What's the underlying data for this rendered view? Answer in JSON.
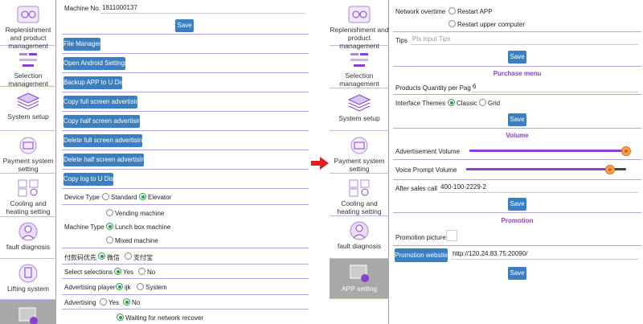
{
  "sidebar_left": [
    {
      "label": "Replenishment and product management",
      "icon": "replenish-icon"
    },
    {
      "label": "Selection management",
      "icon": "selection-icon"
    },
    {
      "label": "System setup",
      "icon": "layers-icon"
    },
    {
      "label": "Payment system setting",
      "icon": "payment-icon"
    },
    {
      "label": "Cooling and heating setting",
      "icon": "cooling-icon"
    },
    {
      "label": "fault diagnosis",
      "icon": "doctor-icon"
    },
    {
      "label": "Lifting system",
      "icon": "lifting-icon"
    },
    {
      "label": "",
      "icon": "app-setting-icon"
    }
  ],
  "sidebar_right": [
    {
      "label": "Replenishment and product management",
      "icon": "replenish-icon"
    },
    {
      "label": "Selection management",
      "icon": "selection-icon"
    },
    {
      "label": "System setup",
      "icon": "layers-icon"
    },
    {
      "label": "Payment system setting",
      "icon": "payment-icon"
    },
    {
      "label": "Cooling and heating setting",
      "icon": "cooling-icon"
    },
    {
      "label": "fault diagnosis",
      "icon": "doctor-icon"
    },
    {
      "label": "APP setting",
      "icon": "app-setting-icon"
    }
  ],
  "left": {
    "machine_no_label": "Machine No.",
    "machine_no_value": "1811000137",
    "save": "Save",
    "buttons": [
      "File Manager",
      "Open Android Settings",
      "Backup APP to U Disk",
      "Copy full screen advertising",
      "Copy half screen advertising",
      "Delete full screen advertising",
      "Delete half screen advertising",
      "Copy log to U Disk"
    ],
    "device_type": {
      "label": "Device Type",
      "options": [
        "Standard",
        "Elevator"
      ]
    },
    "machine_type": {
      "label": "Machine Type",
      "options": [
        "Vending machine",
        "Lunch box machine",
        "Mixed machine"
      ]
    },
    "pay_code": {
      "label": "付款码优先",
      "options": [
        "微信",
        "支付宝"
      ]
    },
    "select_selections": {
      "label": "Select selections",
      "options": [
        "Yes",
        "No"
      ]
    },
    "ad_player": {
      "label": "Advertising player",
      "options": [
        "ijk",
        "System"
      ]
    },
    "advertising": {
      "label": "Advertising",
      "options": [
        "Yes",
        "No"
      ]
    },
    "network_recover": "Waiting for network recover"
  },
  "right": {
    "network_overtime_label": "Network overtime",
    "network_options": [
      "Restart APP",
      "Restart upper computer"
    ],
    "tips_label": "Tips",
    "tips_placeholder": "Pls input Tips",
    "save": "Save",
    "purchase_menu": "Purchase menu",
    "products_qty_label": "Products Quantity per Page",
    "products_qty_value": "6",
    "themes_label": "Interface Themes",
    "themes_options": [
      "Classic",
      "Grid"
    ],
    "volume_title": "Volume",
    "ad_volume_label": "Advertisement Volume",
    "ad_volume_level": 1.0,
    "voice_volume_label": "Voice Prompt Volume",
    "voice_volume_level": 0.9,
    "after_sales_label": "After sales call",
    "after_sales_value": "400-100-2229-2",
    "promotion_title": "Promotion",
    "promotion_picture_label": "Promotion picture",
    "promotion_website_btn": "Promotion website",
    "promotion_url": "http://120.24.83.75:20090/"
  },
  "colors": {
    "accent": "#8a3fd1",
    "button": "#3a7fc1",
    "arrow": "#e02020",
    "radio": "#2d9c4a"
  }
}
